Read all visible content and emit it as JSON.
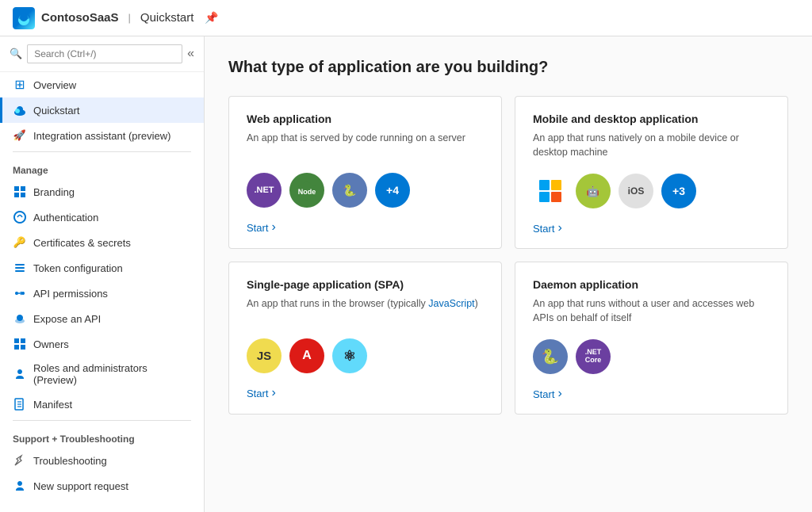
{
  "header": {
    "app_icon_text": "☁",
    "app_name": "ContosoSaaS",
    "separator": "|",
    "page": "Quickstart",
    "pin_icon": "📌"
  },
  "sidebar": {
    "search_placeholder": "Search (Ctrl+/)",
    "collapse_icon": "«",
    "nav_items": [
      {
        "id": "overview",
        "label": "Overview",
        "icon": "grid"
      },
      {
        "id": "quickstart",
        "label": "Quickstart",
        "icon": "cloud",
        "active": true
      },
      {
        "id": "integration",
        "label": "Integration assistant (preview)",
        "icon": "rocket"
      }
    ],
    "manage_label": "Manage",
    "manage_items": [
      {
        "id": "branding",
        "label": "Branding",
        "icon": "branding"
      },
      {
        "id": "authentication",
        "label": "Authentication",
        "icon": "auth"
      },
      {
        "id": "certificates",
        "label": "Certificates & secrets",
        "icon": "cert"
      },
      {
        "id": "token",
        "label": "Token configuration",
        "icon": "token"
      },
      {
        "id": "api-permissions",
        "label": "API permissions",
        "icon": "api"
      },
      {
        "id": "expose-api",
        "label": "Expose an API",
        "icon": "expose"
      },
      {
        "id": "owners",
        "label": "Owners",
        "icon": "owners"
      },
      {
        "id": "roles",
        "label": "Roles and administrators (Preview)",
        "icon": "roles"
      },
      {
        "id": "manifest",
        "label": "Manifest",
        "icon": "manifest"
      }
    ],
    "support_label": "Support + Troubleshooting",
    "support_items": [
      {
        "id": "troubleshooting",
        "label": "Troubleshooting",
        "icon": "trouble"
      },
      {
        "id": "new-support",
        "label": "New support request",
        "icon": "support"
      }
    ]
  },
  "content": {
    "page_title": "What type of application are you building?",
    "cards": [
      {
        "id": "web-app",
        "title": "Web application",
        "description": "An app that is served by code running on a server",
        "tech_icons": [
          {
            "label": ".NET",
            "class": "dotnet",
            "text": ".NET"
          },
          {
            "label": "Node.js",
            "class": "nodejs",
            "text": "⬡"
          },
          {
            "label": "Python",
            "class": "python",
            "text": "🐍"
          },
          {
            "label": "+4",
            "class": "plus-badge",
            "text": "+4"
          }
        ],
        "start_label": "Start"
      },
      {
        "id": "mobile-desktop",
        "title": "Mobile and desktop application",
        "description": "An app that runs natively on a mobile device or desktop machine",
        "tech_icons": [
          {
            "label": "Windows",
            "class": "windows-icon",
            "text": "WIN"
          },
          {
            "label": "Android",
            "class": "android-icon",
            "text": "🤖"
          },
          {
            "label": "iOS",
            "class": "ios-badge",
            "text": "iOS"
          },
          {
            "label": "+3",
            "class": "plus3",
            "text": "+3"
          }
        ],
        "start_label": "Start"
      },
      {
        "id": "spa",
        "title": "Single-page application (SPA)",
        "description": "An app that runs in the browser (typically JavaScript)",
        "tech_icons": [
          {
            "label": "JavaScript",
            "class": "js-icon",
            "text": "JS"
          },
          {
            "label": "Angular",
            "class": "angular-icon",
            "text": "A"
          },
          {
            "label": "React",
            "class": "react-icon",
            "text": "⚛"
          }
        ],
        "start_label": "Start"
      },
      {
        "id": "daemon",
        "title": "Daemon application",
        "description": "An app that runs without a user and accesses web APIs on behalf of itself",
        "tech_icons": [
          {
            "label": "Python",
            "class": "py2",
            "text": "🐍"
          },
          {
            "label": ".NET Core",
            "class": "dotnetcore",
            "text": ".NET Core"
          }
        ],
        "start_label": "Start"
      }
    ]
  },
  "icons": {
    "grid": "⊞",
    "cloud": "☁",
    "rocket": "🚀",
    "branding": "▣",
    "auth": "↻",
    "cert": "🔑",
    "token": "⋮⋮",
    "api": "↔",
    "expose": "☁",
    "owners": "⊞",
    "roles": "👤",
    "manifest": "▤",
    "trouble": "🔧",
    "support": "👤",
    "chevron_right": "›"
  }
}
